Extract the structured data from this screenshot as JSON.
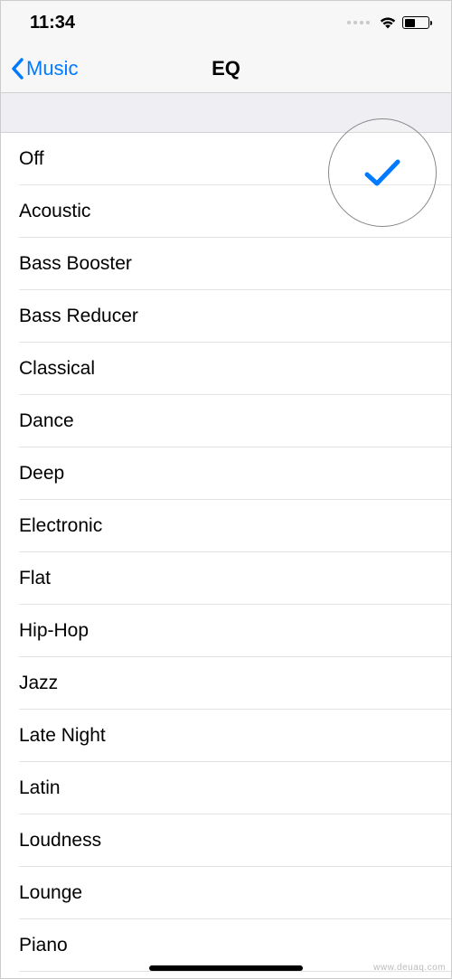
{
  "status": {
    "time": "11:34"
  },
  "nav": {
    "back_label": "Music",
    "title": "EQ"
  },
  "eq": {
    "selected_index": 0,
    "items": [
      {
        "label": "Off"
      },
      {
        "label": "Acoustic"
      },
      {
        "label": "Bass Booster"
      },
      {
        "label": "Bass Reducer"
      },
      {
        "label": "Classical"
      },
      {
        "label": "Dance"
      },
      {
        "label": "Deep"
      },
      {
        "label": "Electronic"
      },
      {
        "label": "Flat"
      },
      {
        "label": "Hip-Hop"
      },
      {
        "label": "Jazz"
      },
      {
        "label": "Late Night"
      },
      {
        "label": "Latin"
      },
      {
        "label": "Loudness"
      },
      {
        "label": "Lounge"
      },
      {
        "label": "Piano"
      }
    ]
  },
  "watermark": "www.deuaq.com"
}
